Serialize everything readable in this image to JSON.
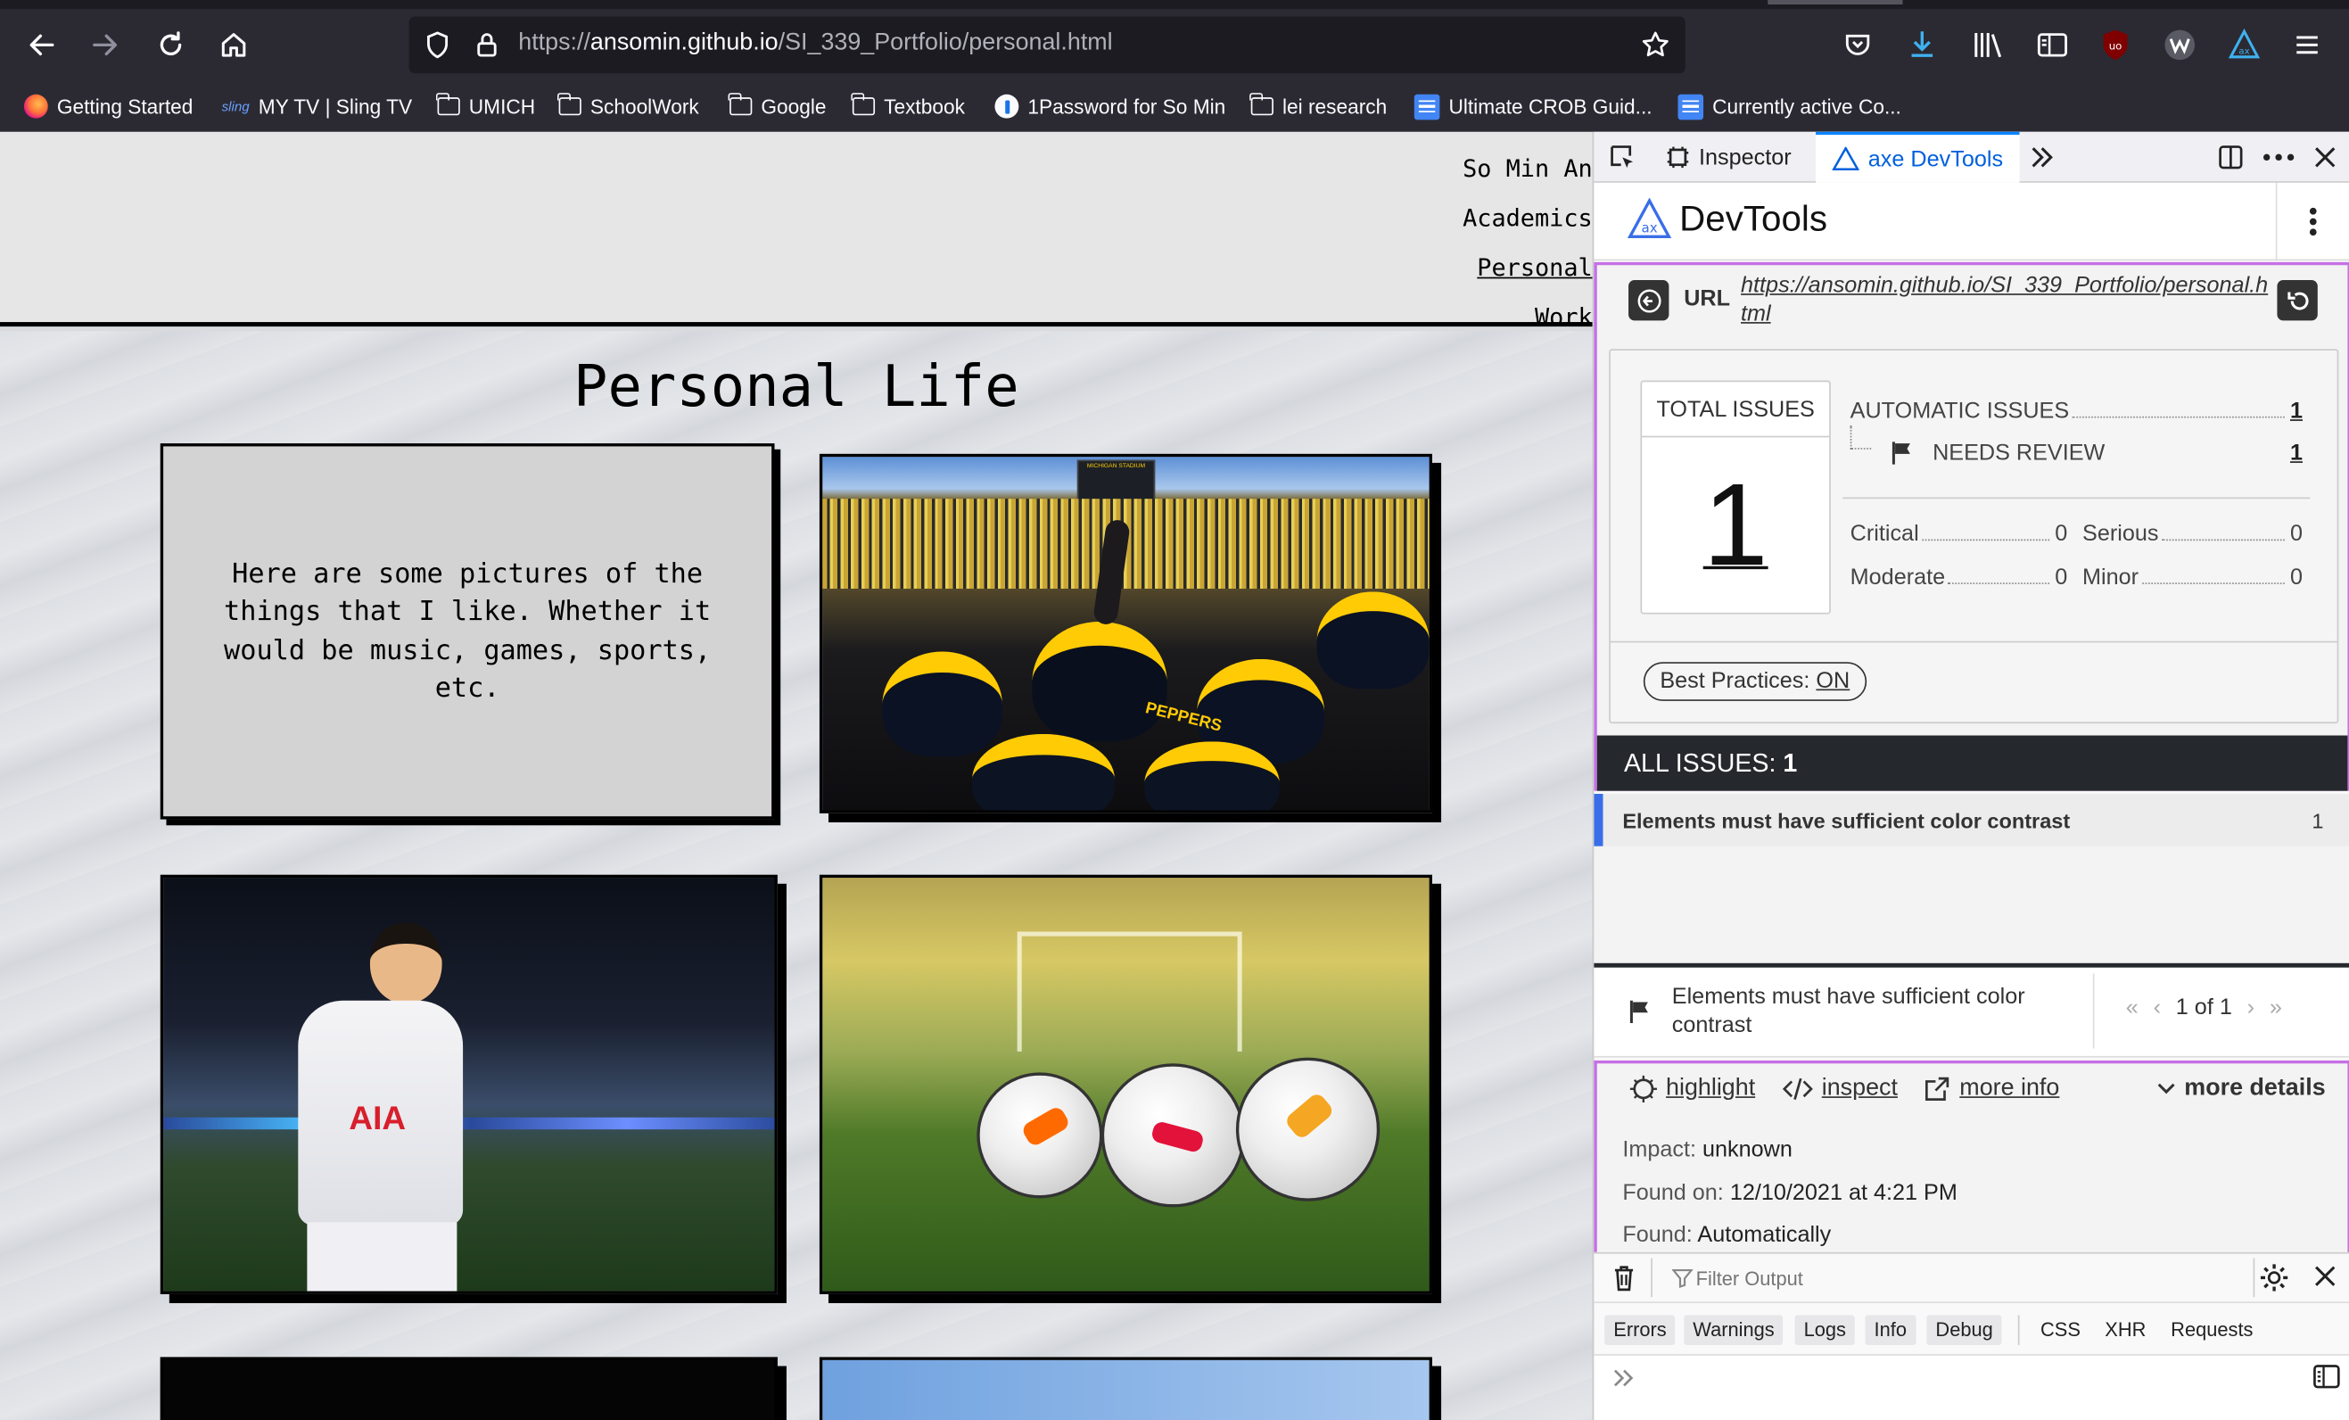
{
  "browser": {
    "url_prefix": "https://",
    "url_domain": "ansomin.github.io",
    "url_path": "/SI_339_Portfolio/personal.html"
  },
  "bookmarks": [
    {
      "label": "Getting Started",
      "icon": "firefox-icon"
    },
    {
      "label": "MY TV | Sling TV",
      "icon": "sling-icon",
      "icon_text": "sling"
    },
    {
      "label": "UMICH",
      "icon": "folder-icon"
    },
    {
      "label": "SchoolWork",
      "icon": "folder-icon"
    },
    {
      "label": "Google",
      "icon": "folder-icon"
    },
    {
      "label": "Textbook",
      "icon": "folder-icon"
    },
    {
      "label": "1Password for So Min",
      "icon": "onepassword-icon"
    },
    {
      "label": "lei research",
      "icon": "folder-icon"
    },
    {
      "label": "Ultimate CROB Guid...",
      "icon": "doc-icon"
    },
    {
      "label": "Currently active Co...",
      "icon": "doc-icon"
    }
  ],
  "site": {
    "nav": [
      "So Min An",
      "Academics",
      "Personal",
      "Work"
    ],
    "title": "Personal Life",
    "intro": "Here are some pictures of the things that I like. Whether it would be music, games, sports, etc.",
    "photo_labels": {
      "helmet": "PEPPERS",
      "banner": "MICHIGAN STADIUM",
      "jersey": "AIA"
    }
  },
  "devtools": {
    "tabs": {
      "inspector": "Inspector",
      "axe": "axe DevTools"
    },
    "brand": "DevTools",
    "url_label": "URL",
    "url_value": "https://ansomin.github.io/SI_339_Portfolio/personal.html",
    "total_label": "TOTAL ISSUES",
    "total_value": "1",
    "automatic_label": "AUTOMATIC ISSUES",
    "automatic_value": "1",
    "review_label": "NEEDS REVIEW",
    "review_value": "1",
    "critical_label": "Critical",
    "critical_value": "0",
    "serious_label": "Serious",
    "serious_value": "0",
    "moderate_label": "Moderate",
    "moderate_value": "0",
    "minor_label": "Minor",
    "minor_value": "0",
    "best_label": "Best Practices:",
    "best_value": "ON",
    "all_label": "ALL ISSUES:",
    "all_value": "1",
    "issue_text": "Elements must have sufficient color contrast",
    "issue_count": "1",
    "detail_title": "Elements must have sufficient color contrast",
    "pager": "1 of 1",
    "highlight": "highlight",
    "inspect": "inspect",
    "more_info": "more info",
    "more_details": "more details",
    "impact_label": "Impact:",
    "impact_value": "unknown",
    "found_on_label": "Found on:",
    "found_on_value": "12/10/2021 at 4:21 PM",
    "found_label": "Found:",
    "found_value": "Automatically",
    "filter_placeholder": "Filter Output",
    "console_tabs": [
      "Errors",
      "Warnings",
      "Logs",
      "Info",
      "Debug"
    ],
    "console_plain": [
      "CSS",
      "XHR",
      "Requests"
    ]
  }
}
